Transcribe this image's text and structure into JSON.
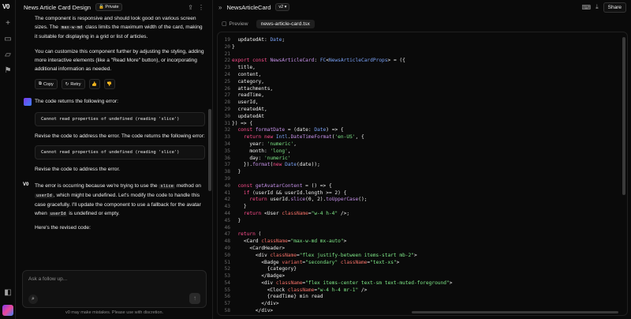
{
  "chat": {
    "title": "News Article Card Design",
    "private_label": "Private",
    "p1": "The component is responsive and should look good on various screen sizes. The",
    "p1_code": "max-w-md",
    "p1_rest": "class limits the maximum width of the card, making it suitable for displaying in a grid or list of articles.",
    "p2": "You can customize this component further by adjusting the styling, adding more interactive elements (like a \"Read More\" button), or incorporating additional information as needed.",
    "copy_label": "Copy",
    "retry_label": "Retry",
    "user_msg1": "The code returns the following error:",
    "error_code": "Cannot read properties of undefined (reading 'slice')",
    "user_msg2": "Revise the code to address the error. The code returns the following error:",
    "user_msg3": "Revise the code to address the error.",
    "reply_a": "The error is occurring because we're trying to use the",
    "reply_code1": "slice",
    "reply_b": "method on",
    "reply_code2": "userId",
    "reply_c": ", which might be undefined. Let's modify the code to handle this case gracefully. I'll update the component to use a fallback for the avatar when",
    "reply_code3": "userId",
    "reply_d": "is undefined or empty.",
    "revised": "Here's the revised code:",
    "input_placeholder": "Ask a follow up...",
    "disclaimer": "v0 may make mistakes. Please use with discretion."
  },
  "rail": {
    "logo": "V0"
  },
  "editor": {
    "title": "NewsArticleCard",
    "version": "v2",
    "share_label": "Share",
    "tab_preview": "Preview",
    "tab_file": "news-article-card.tsx",
    "lines": [
      {
        "n": "19",
        "t": "  updatedAt: Date;"
      },
      {
        "n": "20",
        "t": "}"
      },
      {
        "n": "21",
        "t": ""
      },
      {
        "n": "22",
        "t": "export const NewsArticleCard: FC<NewsArticleCardProps> = ({"
      },
      {
        "n": "23",
        "t": "  title,"
      },
      {
        "n": "24",
        "t": "  content,"
      },
      {
        "n": "25",
        "t": "  category,"
      },
      {
        "n": "26",
        "t": "  attachments,"
      },
      {
        "n": "27",
        "t": "  readTime,"
      },
      {
        "n": "28",
        "t": "  userId,"
      },
      {
        "n": "29",
        "t": "  createdAt,"
      },
      {
        "n": "30",
        "t": "  updatedAt"
      },
      {
        "n": "31",
        "t": "}) => {"
      },
      {
        "n": "32",
        "t": "  const formatDate = (date: Date) => {"
      },
      {
        "n": "33",
        "t": "    return new Intl.DateTimeFormat('en-US', {"
      },
      {
        "n": "34",
        "t": "      year: 'numeric',"
      },
      {
        "n": "35",
        "t": "      month: 'long',"
      },
      {
        "n": "36",
        "t": "      day: 'numeric'"
      },
      {
        "n": "37",
        "t": "    }).format(new Date(date));"
      },
      {
        "n": "38",
        "t": "  }"
      },
      {
        "n": "39",
        "t": ""
      },
      {
        "n": "40",
        "t": "  const getAvatarContent = () => {"
      },
      {
        "n": "41",
        "t": "    if (userId && userId.length >= 2) {"
      },
      {
        "n": "42",
        "t": "      return userId.slice(0, 2).toUpperCase();"
      },
      {
        "n": "43",
        "t": "    }"
      },
      {
        "n": "44",
        "t": "    return <User className=\"w-4 h-4\" />;"
      },
      {
        "n": "45",
        "t": "  }"
      },
      {
        "n": "46",
        "t": ""
      },
      {
        "n": "47",
        "t": "  return ("
      },
      {
        "n": "48",
        "t": "    <Card className=\"max-w-md mx-auto\">"
      },
      {
        "n": "49",
        "t": "      <CardHeader>"
      },
      {
        "n": "50",
        "t": "        <div className=\"flex justify-between items-start mb-2\">"
      },
      {
        "n": "51",
        "t": "          <Badge variant=\"secondary\" className=\"text-xs\">"
      },
      {
        "n": "52",
        "t": "            {category}"
      },
      {
        "n": "53",
        "t": "          </Badge>"
      },
      {
        "n": "54",
        "t": "          <div className=\"flex items-center text-sm text-muted-foreground\">"
      },
      {
        "n": "55",
        "t": "            <Clock className=\"w-4 h-4 mr-1\" />"
      },
      {
        "n": "56",
        "t": "            {readTime} min read"
      },
      {
        "n": "57",
        "t": "          </div>"
      },
      {
        "n": "58",
        "t": "        </div>"
      }
    ]
  },
  "colors": {
    "background": "#0a0a0a",
    "keyword": "#ff4d8d",
    "function": "#c792ea",
    "string": "#7ee787",
    "type": "#7aa2f7"
  }
}
